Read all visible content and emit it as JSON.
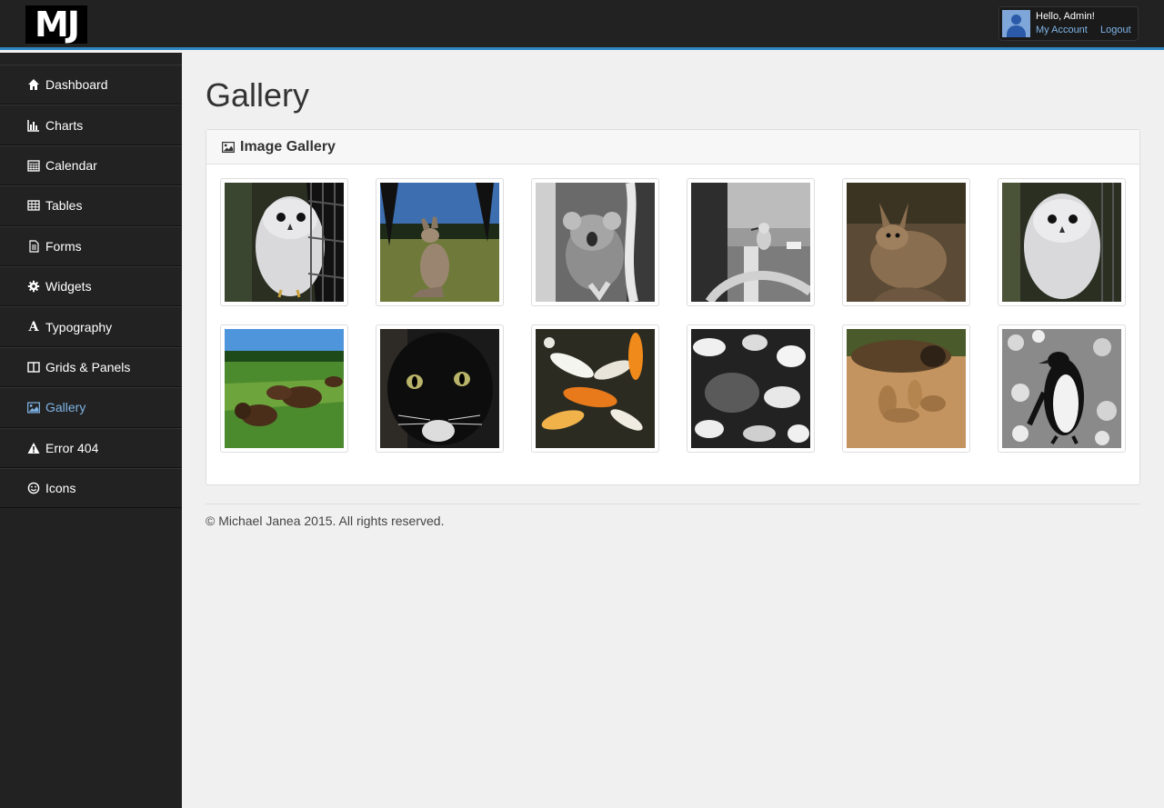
{
  "brand": {
    "logo_text": "MJ"
  },
  "user": {
    "greeting": "Hello, Admin!",
    "account_label": "My Account",
    "logout_label": "Logout"
  },
  "sidebar": {
    "items": [
      {
        "label": "Dashboard",
        "icon": "home-icon"
      },
      {
        "label": "Charts",
        "icon": "bar-chart-icon"
      },
      {
        "label": "Calendar",
        "icon": "calendar-icon"
      },
      {
        "label": "Tables",
        "icon": "table-icon"
      },
      {
        "label": "Forms",
        "icon": "file-icon"
      },
      {
        "label": "Widgets",
        "icon": "gear-icon"
      },
      {
        "label": "Typography",
        "icon": "font-icon"
      },
      {
        "label": "Grids & Panels",
        "icon": "columns-icon"
      },
      {
        "label": "Gallery",
        "icon": "picture-icon",
        "active": true
      },
      {
        "label": "Error 404",
        "icon": "warning-icon"
      },
      {
        "label": "Icons",
        "icon": "smile-icon"
      }
    ]
  },
  "page": {
    "title": "Gallery"
  },
  "gallery": {
    "panel_title": "Image Gallery",
    "panel_icon": "picture-icon",
    "images": [
      {
        "subject": "owl"
      },
      {
        "subject": "kangaroo"
      },
      {
        "subject": "koala"
      },
      {
        "subject": "kookaburra"
      },
      {
        "subject": "wallaby"
      },
      {
        "subject": "owl"
      },
      {
        "subject": "bison"
      },
      {
        "subject": "cat"
      },
      {
        "subject": "koi-fish"
      },
      {
        "subject": "leaves"
      },
      {
        "subject": "meerkats"
      },
      {
        "subject": "penguin"
      }
    ]
  },
  "footer": {
    "text": "© Michael Janea 2015. All rights reserved."
  },
  "colors": {
    "accent": "#2e86c1",
    "link": "#7fb4e6",
    "sidebar_bg": "#222222",
    "content_bg": "#f0f0f0"
  }
}
